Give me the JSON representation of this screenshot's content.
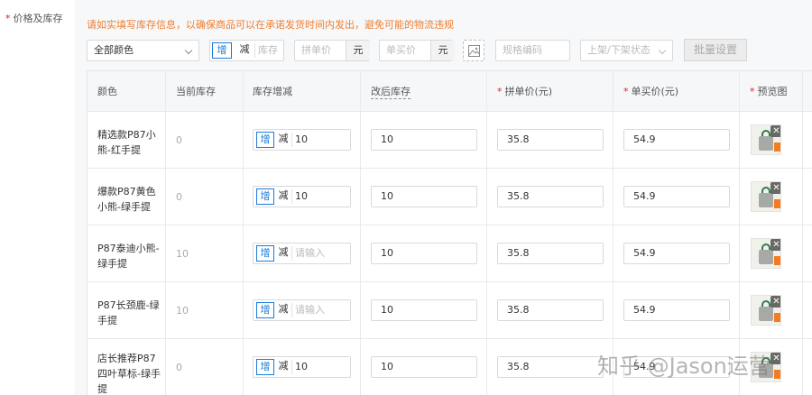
{
  "section": {
    "required_mark": "*",
    "label": "价格及库存"
  },
  "notice": "请如实填写库存信息，以确保商品可以在承诺发货时间内发出，避免可能的物流违规",
  "toolbar": {
    "color_select": "全部颜色",
    "stock_toggle": {
      "add": "增",
      "reduce": "减",
      "placeholder": "库存"
    },
    "pin_price": {
      "placeholder": "拼单价",
      "unit": "元"
    },
    "single_price": {
      "placeholder": "单买价",
      "unit": "元"
    },
    "image_icon": "image-icon",
    "sku_code": {
      "placeholder": "规格编码"
    },
    "status_select": {
      "placeholder": "上架/下架状态"
    },
    "batch_button": "批量设置"
  },
  "table": {
    "headers": {
      "color": "颜色",
      "current_stock": "当前库存",
      "stock_change": "库存增减",
      "after_stock": "改后库存",
      "pin_price": "拼单价(元)",
      "single_price": "单买价(元)",
      "preview": "预览图",
      "required_mark": "*"
    },
    "stepper": {
      "add": "增",
      "reduce": "减",
      "placeholder": "请输入"
    },
    "rows": [
      {
        "name": "精选款P87小熊-红手提",
        "current_stock": "0",
        "change": "10",
        "after": "10",
        "pin_price": "35.8",
        "single_price": "54.9"
      },
      {
        "name": "爆款P87黄色小熊-绿手提",
        "current_stock": "0",
        "change": "10",
        "after": "10",
        "pin_price": "35.8",
        "single_price": "54.9"
      },
      {
        "name": "P87泰迪小熊-绿手提",
        "current_stock": "10",
        "change": "",
        "after": "10",
        "pin_price": "35.8",
        "single_price": "54.9"
      },
      {
        "name": "P87长颈鹿-绿手提",
        "current_stock": "10",
        "change": "",
        "after": "10",
        "pin_price": "35.8",
        "single_price": "54.9"
      },
      {
        "name": "店长推荐P87四叶草标-绿手提",
        "current_stock": "0",
        "change": "10",
        "after": "10",
        "pin_price": "35.8",
        "single_price": "54.9"
      }
    ],
    "thumb_close": "✕"
  },
  "watermark": "知乎 @Jason运营",
  "colors": {
    "accent": "#1e7bd6",
    "required": "#e02020",
    "notice": "#f07d2d"
  }
}
